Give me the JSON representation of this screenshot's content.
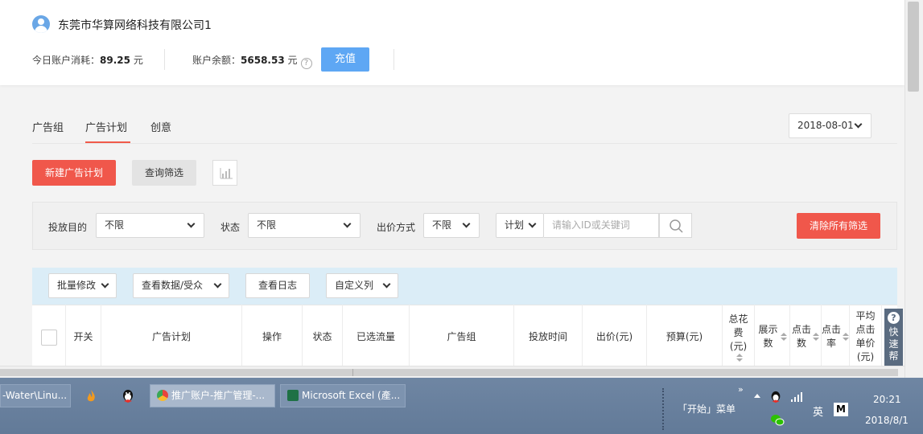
{
  "account": {
    "company_name": "东莞市华算网络科技有限公司1",
    "today_spend_label": "今日账户消耗：",
    "today_spend_value": "89.25",
    "today_spend_unit": "元",
    "balance_label": "账户余额：",
    "balance_value": "5658.53",
    "balance_unit": "元",
    "help_glyph": "?",
    "recharge_label": "充值"
  },
  "tabs": [
    {
      "label": "广告组",
      "active": false
    },
    {
      "label": "广告计划",
      "active": true
    },
    {
      "label": "创意",
      "active": false
    }
  ],
  "date_picker": {
    "value": "2018-08-01"
  },
  "actions": {
    "new_plan_label": "新建广告计划",
    "query_filter_label": "查询筛选",
    "chart_icon": "bar-chart-icon"
  },
  "filters": {
    "goal_label": "投放目的",
    "goal_value": "不限",
    "status_label": "状态",
    "status_value": "不限",
    "bid_label": "出价方式",
    "bid_value": "不限",
    "search_type": "计划",
    "search_placeholder": "请输入ID或关键词",
    "clear_label": "清除所有筛选"
  },
  "toolbar": {
    "batch_edit": "批量修改",
    "view_data": "查看数据/受众",
    "view_log": "查看日志",
    "custom_cols": "自定义列"
  },
  "table": {
    "columns": [
      "开关",
      "广告计划",
      "操作",
      "状态",
      "已选流量",
      "广告组",
      "投放时间",
      "出价(元)",
      "预算(元)",
      "总花费(元)",
      "展示数",
      "点击数",
      "点击率",
      "平均点击单价(元)"
    ],
    "col_total_spend": [
      "总花",
      "费",
      "(元)"
    ],
    "col_impressions": "展示数",
    "col_clicks": [
      "点击",
      "数"
    ],
    "col_ctr": [
      "点击",
      "率"
    ],
    "col_cpc": [
      "平均",
      "点击",
      "单价",
      "(元)"
    ]
  },
  "quick_help": {
    "glyph": "?",
    "label_chars": [
      "快",
      "速",
      "帮",
      "助"
    ]
  },
  "taskbar": {
    "item1": "-Water\\Linu...",
    "item_browser": "推广账户-推广管理-...",
    "item_excel": "Microsoft Excel (產...",
    "start_menu": "「开始」菜单",
    "expand_arrows": "»",
    "ime": "英",
    "ime_mode": "M",
    "time": "20:21",
    "date": "2018/8/1"
  },
  "colors": {
    "primary_red": "#f0574b",
    "recharge_blue": "#5ea7f4",
    "toolbar_blue": "#dbedf7",
    "taskbar": "#6a819e"
  }
}
